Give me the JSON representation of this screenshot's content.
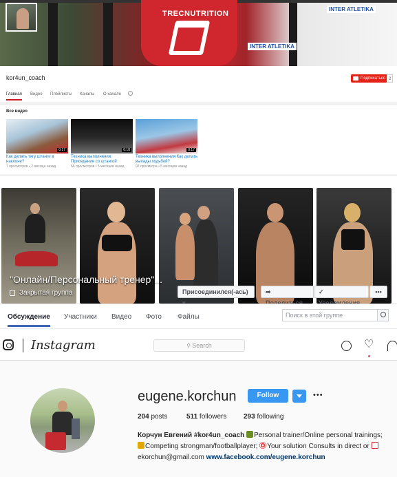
{
  "youtube": {
    "channel_name": "kor4un_coach",
    "subscribe_label": "Подписаться",
    "subscriber_count": "2",
    "tabs": [
      "Главная",
      "Видео",
      "Плейлисты",
      "Каналы",
      "О канале"
    ],
    "section_title": "Все видео",
    "banner_text": {
      "shirt": "TRECNUTRITION",
      "sponsor1": "INTER ATLETIKA",
      "sponsor2": "INTER ATLETIKA"
    },
    "videos": [
      {
        "title": "Как делать тягу штанги в наклоне?",
        "meta": "7 просмотров • 2 месяца назад",
        "duration": "0:17"
      },
      {
        "title": "Техника выполнения: Приседание со штангой",
        "meta": "66 просмотров • 5 месяцев назад",
        "duration": "0:18"
      },
      {
        "title": "Техника выполнения:Как делать выпады ходьбой?",
        "meta": "92 просмотра • 5 месяцев назад",
        "duration": "0:17"
      }
    ]
  },
  "facebook": {
    "group_title": "\"Онлайн/Персональный тренер\"...",
    "privacy": "Закрытая группа",
    "joined_label": "Присоединился(-ась)",
    "share_label": "Поделиться",
    "notifications_label": "Уведомления",
    "more_label": "•••",
    "tabs": [
      "Обсуждение",
      "Участники",
      "Видео",
      "Фото",
      "Файлы"
    ],
    "search_placeholder": "Поиск в этой группе"
  },
  "instagram": {
    "logo": "Instagram",
    "search_placeholder": "Search",
    "username": "eugene.korchun",
    "follow_label": "Follow",
    "more": "•••",
    "posts": "204",
    "posts_label": "posts",
    "followers": "511",
    "followers_label": "followers",
    "following": "293",
    "following_label": "following",
    "bio_name": "Корчун Евгений #kor4un_coach",
    "bio_line1": "Personal trainer/Online personal trainings;",
    "bio_line2a": "Competing strongman/footballplayer;",
    "bio_line2b": "Your solution Consults in direct or",
    "bio_email": "ekorchun@gmail.com",
    "bio_link": "www.facebook.com/eugene.korchun",
    "accent_color": "#3897f0"
  },
  "colors": {
    "youtube_red": "#e62117",
    "facebook_blue": "#4267b2",
    "instagram_blue": "#3897f0"
  }
}
